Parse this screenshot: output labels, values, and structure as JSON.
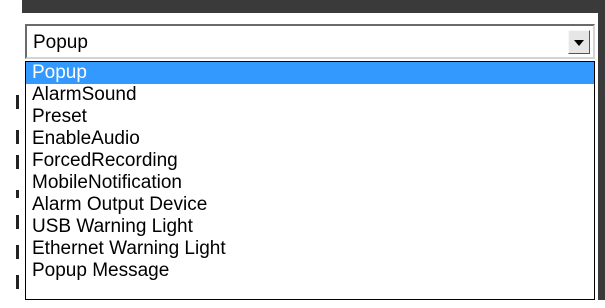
{
  "select": {
    "value": "Popup",
    "arrow_icon": "dropdown-arrow-icon"
  },
  "dropdown": {
    "selected_index": 0,
    "options": [
      "Popup",
      "AlarmSound",
      "Preset",
      "EnableAudio",
      "ForcedRecording",
      "MobileNotification",
      "Alarm Output Device",
      "USB Warning Light",
      "Ethernet Warning Light",
      "Popup Message"
    ]
  },
  "colors": {
    "selection": "#3399ff",
    "frame": "#3a3a3a"
  }
}
